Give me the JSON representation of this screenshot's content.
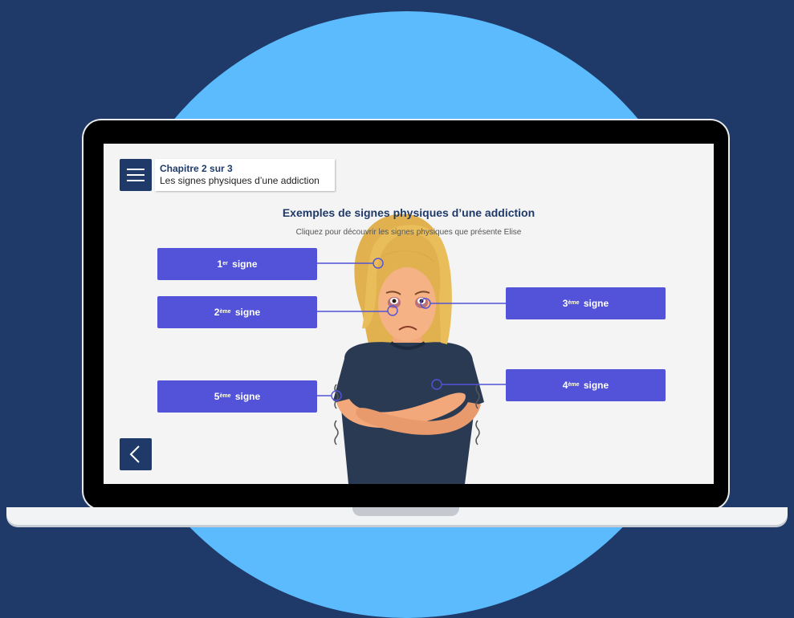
{
  "header": {
    "chapter_number": "Chapitre 2 sur 3",
    "chapter_title": "Les signes physiques d’une addiction"
  },
  "main": {
    "title": "Exemples de signes physiques d’une addiction",
    "subtitle": "Cliquez pour découvrir les signes physiques que présente Elise"
  },
  "signs": [
    {
      "num": "1",
      "sup": "er",
      "label": "signe"
    },
    {
      "num": "2",
      "sup": "ème",
      "label": "signe"
    },
    {
      "num": "3",
      "sup": "ème",
      "label": "signe"
    },
    {
      "num": "4",
      "sup": "ème",
      "label": "signe"
    },
    {
      "num": "5",
      "sup": "ème",
      "label": "signe"
    }
  ],
  "colors": {
    "navy": "#1f3a68",
    "sky": "#5bbbfd",
    "button": "#5253d8"
  },
  "icons": {
    "menu": "hamburger-icon",
    "back": "chevron-left-icon"
  }
}
